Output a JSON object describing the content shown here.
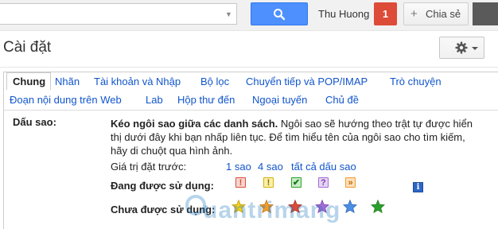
{
  "topbar": {
    "search_placeholder": "",
    "user_name": "Thu Huong",
    "notifications_count": "1",
    "share_label": "Chia sẻ"
  },
  "page_title": "Cài đặt",
  "tabs": [
    {
      "label": "Chung",
      "active": true
    },
    {
      "label": "Nhãn"
    },
    {
      "label": "Tài khoản và Nhập"
    },
    {
      "label": "Bộ lọc"
    },
    {
      "label": "Chuyển tiếp và POP/IMAP"
    },
    {
      "label": "Trò chuyện"
    },
    {
      "label": "Đoạn nội dung trên Web"
    },
    {
      "label": "Lab"
    },
    {
      "label": "Hộp thư đến"
    },
    {
      "label": "Ngoại tuyến"
    },
    {
      "label": "Chủ đề"
    }
  ],
  "stars_section": {
    "label": "Dấu sao:",
    "desc_bold": "Kéo ngôi sao giữa các danh sách.",
    "desc_text": " Ngôi sao sẽ hướng theo trật tự được hiển thị dưới đây khi bạn nhấp liên tục. Để tìm hiểu tên của ngôi sao cho tìm kiếm, hãy di chuột qua hình ảnh.",
    "presets_label": "Giá trị đặt trước:",
    "presets": [
      "1 sao",
      "4 sao",
      "tất cả dấu sao"
    ],
    "in_use_label": "Đang được sử dụng:",
    "not_in_use_label": "Chưa được sử dụng:",
    "in_use_icons": [
      "red-bang-icon",
      "yellow-bang-icon",
      "green-check-icon",
      "purple-question-icon",
      "orange-guillemet-icon"
    ],
    "not_in_use_icons": [
      "yellow-star-icon",
      "orange-star-icon",
      "red-star-icon",
      "purple-star-icon",
      "blue-star-icon",
      "green-star-icon"
    ],
    "info_icon": "blue-info-icon",
    "colors": {
      "red": "#dd4b39",
      "yellow": "#f7d117",
      "green": "#2ca02c",
      "purple": "#a46bd6",
      "orange": "#f39c27",
      "blue": "#4b8fe6"
    }
  },
  "watermark": "uantrimang",
  "colors": {
    "link": "#1155cc",
    "search_button": "#4d90fe",
    "notification": "#dd4b39"
  }
}
